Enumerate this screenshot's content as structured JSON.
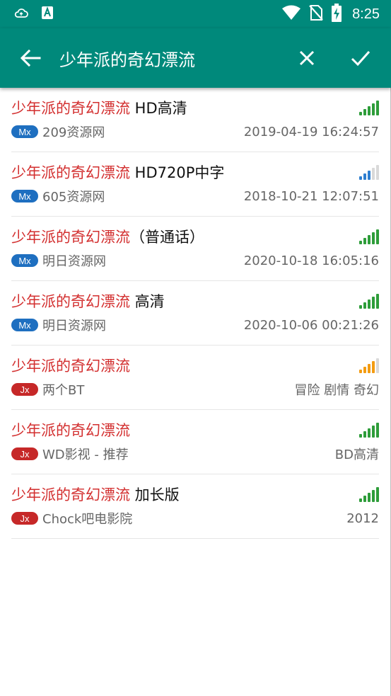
{
  "status_bar": {
    "time": "8:25",
    "icons": [
      "cloud-sync-icon",
      "app-notification-icon",
      "wifi-icon",
      "no-sim-icon",
      "battery-charging-icon"
    ]
  },
  "toolbar": {
    "query": "少年派的奇幻漂流",
    "back_icon": "arrow-left-icon",
    "close_icon": "close-icon",
    "confirm_icon": "check-icon"
  },
  "colors": {
    "toolbar": "#00897b",
    "highlight": "#d32f2f",
    "badge_mx": "#1e6fc0",
    "badge_jx": "#c62828",
    "signal_green": "#2e9d3a",
    "signal_blue": "#2f7fd0",
    "signal_orange": "#f39c12",
    "signal_empty": "#d9d9d9"
  },
  "results": [
    {
      "title_match": "少年派的奇幻漂流",
      "title_rest": " HD高清",
      "badge": "Mx",
      "source": "209资源网",
      "meta": "2019-04-19 16:24:57",
      "signal_level": 5,
      "signal_color": "green"
    },
    {
      "title_match": "少年派的奇幻漂流",
      "title_rest": " HD720P中字",
      "badge": "Mx",
      "source": "605资源网",
      "meta": "2018-10-21 12:07:51",
      "signal_level": 3,
      "signal_color": "blue"
    },
    {
      "title_match": "少年派的奇幻漂流",
      "title_rest": "（普通话）",
      "badge": "Mx",
      "source": "明日资源网",
      "meta": "2020-10-18 16:05:16",
      "signal_level": 5,
      "signal_color": "green"
    },
    {
      "title_match": "少年派的奇幻漂流",
      "title_rest": " 高清",
      "badge": "Mx",
      "source": "明日资源网",
      "meta": "2020-10-06 00:21:26",
      "signal_level": 5,
      "signal_color": "green"
    },
    {
      "title_match": "少年派的奇幻漂流",
      "title_rest": "",
      "badge": "Jx",
      "source": "两个BT",
      "meta": "冒险 剧情 奇幻",
      "signal_level": 4,
      "signal_color": "orange"
    },
    {
      "title_match": "少年派的奇幻漂流",
      "title_rest": "",
      "badge": "Jx",
      "source": "WD影视 - 推荐",
      "meta": "BD高清",
      "signal_level": 5,
      "signal_color": "green"
    },
    {
      "title_match": "少年派的奇幻漂流",
      "title_rest": " 加长版",
      "badge": "Jx",
      "source": "Chock吧电影院",
      "meta": "2012",
      "signal_level": 5,
      "signal_color": "green"
    }
  ]
}
